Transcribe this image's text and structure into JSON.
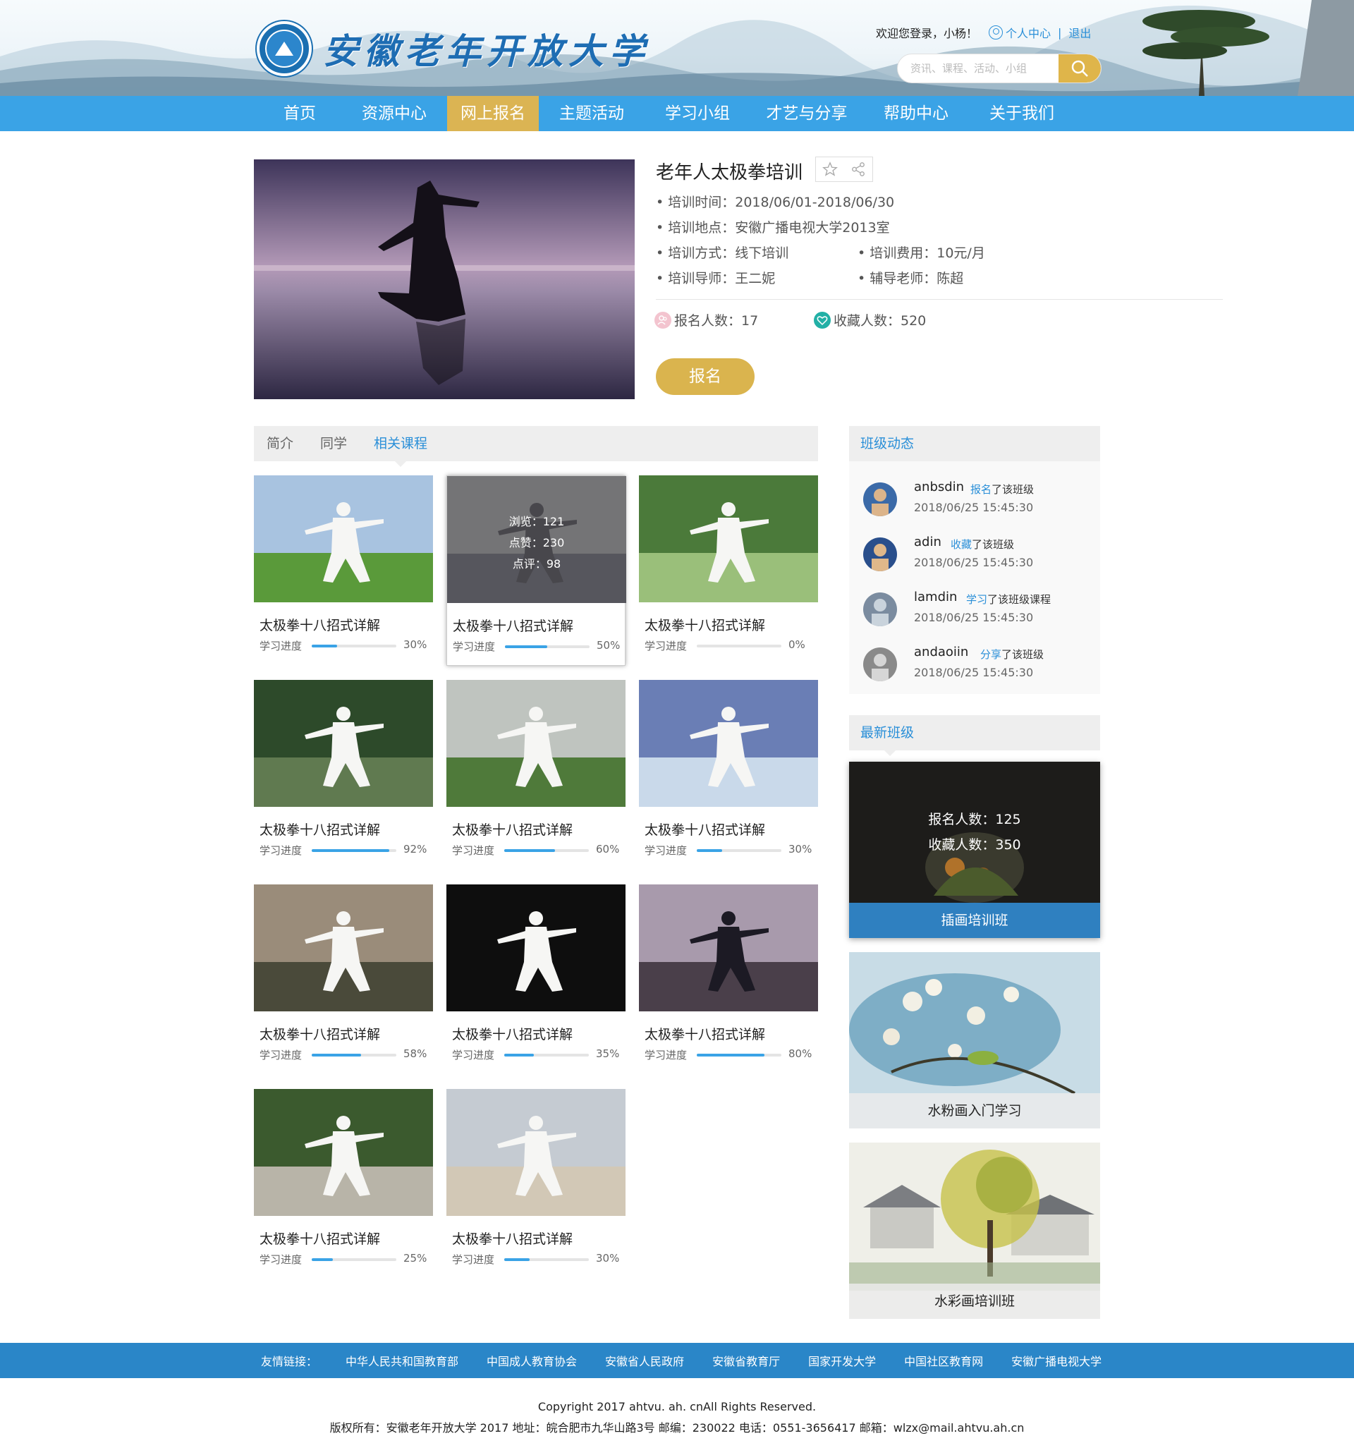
{
  "site": {
    "logo_text": "安徽老年开放大学",
    "welcome": "欢迎您登录，小杨！",
    "user_center": "个人中心",
    "separator": "|",
    "logout": "退出",
    "search_placeholder": "资讯、课程、活动、小组"
  },
  "nav": {
    "items": [
      "首页",
      "资源中心",
      "网上报名",
      "主题活动",
      "学习小组",
      "才艺与分享",
      "帮助中心",
      "关于我们"
    ],
    "active_index": 2
  },
  "detail": {
    "title": "老年人太极拳培训",
    "time": "• 培训时间：2018/06/01-2018/06/30",
    "place": "• 培训地点：安徽广播电视大学2013室",
    "mode": "• 培训方式：线下培训",
    "fee": "• 培训费用：10元/月",
    "mentor": "• 培训导师：王二妮",
    "tutor": "• 辅导老师：陈超",
    "enrolled": "报名人数：17",
    "favorites": "收藏人数：520",
    "enroll_button": "报名"
  },
  "tabs": [
    "简介",
    "同学",
    "相关课程"
  ],
  "active_tab": 2,
  "courses": [
    {
      "title": "太极拳十八招式详解",
      "label": "学习进度",
      "progress": 30,
      "progress_text": "30%"
    },
    {
      "title": "太极拳十八招式详解",
      "label": "学习进度",
      "progress": 50,
      "progress_text": "50%",
      "overlay": [
        "浏览：121",
        "点赞：230",
        "点评：98"
      ]
    },
    {
      "title": "太极拳十八招式详解",
      "label": "学习进度",
      "progress": 0,
      "progress_text": "0%"
    },
    {
      "title": "太极拳十八招式详解",
      "label": "学习进度",
      "progress": 92,
      "progress_text": "92%"
    },
    {
      "title": "太极拳十八招式详解",
      "label": "学习进度",
      "progress": 60,
      "progress_text": "60%"
    },
    {
      "title": "太极拳十八招式详解",
      "label": "学习进度",
      "progress": 30,
      "progress_text": "30%"
    },
    {
      "title": "太极拳十八招式详解",
      "label": "学习进度",
      "progress": 58,
      "progress_text": "58%"
    },
    {
      "title": "太极拳十八招式详解",
      "label": "学习进度",
      "progress": 35,
      "progress_text": "35%"
    },
    {
      "title": "太极拳十八招式详解",
      "label": "学习进度",
      "progress": 80,
      "progress_text": "80%"
    },
    {
      "title": "太极拳十八招式详解",
      "label": "学习进度",
      "progress": 25,
      "progress_text": "25%"
    },
    {
      "title": "太极拳十八招式详解",
      "label": "学习进度",
      "progress": 30,
      "progress_text": "30%"
    }
  ],
  "sidebar": {
    "activity_title": "班级动态",
    "activities": [
      {
        "name": "anbsdin",
        "verb": "报名",
        "rest": "了该班级",
        "time": "2018/06/25  15:45:30"
      },
      {
        "name": "adin",
        "verb": "收藏",
        "rest": "了该班级",
        "time": "2018/06/25  15:45:30"
      },
      {
        "name": "lamdin",
        "verb": "学习",
        "rest": "了该班级课程",
        "time": "2018/06/25  15:45:30"
      },
      {
        "name": "andaoiin",
        "verb": "分享",
        "rest": "了该班级",
        "time": "2018/06/25  15:45:30"
      }
    ],
    "classes_title": "最新班级",
    "classes": [
      {
        "name": "插画培训班",
        "enrolled": "报名人数：125",
        "favorites": "收藏人数：350"
      },
      {
        "name": "水粉画入门学习"
      },
      {
        "name": "水彩画培训班"
      }
    ]
  },
  "footer": {
    "links_label": "友情链接：",
    "links": [
      "中华人民共和国教育部",
      "中国成人教育协会",
      "安徽省人民政府",
      "安徽省教育厅",
      "国家开发大学",
      "中国社区教育网",
      "安徽广播电视大学"
    ],
    "copyright": "Copyright 2017 ahtvu. ah. cnAll Rights Reserved.",
    "info": "版权所有：安徽老年开放大学 2017 地址：皖合肥市九华山路3号 邮编：230022 电话：0551-3656417 邮箱：wlzx@mail.ahtvu.ah.cn"
  },
  "colors": {
    "nav": "#3aa3e6",
    "nav_active": "#dbb453",
    "accent": "#2a8fd8",
    "button": "#dab44e",
    "footer": "#2a86c8"
  }
}
